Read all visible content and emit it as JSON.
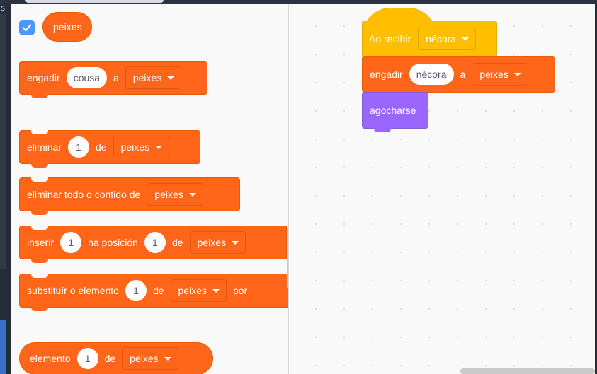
{
  "window": {
    "edge_letter": "s"
  },
  "palette": {
    "variable_checked": true,
    "variable_name": "peixes",
    "blocks": {
      "add": {
        "label1": "engadir",
        "text": "cousa",
        "label2": "a",
        "list": "peixes"
      },
      "delete": {
        "label1": "eliminar",
        "num": "1",
        "label2": "de",
        "list": "peixes"
      },
      "delete_all": {
        "label1": "eliminar todo o contido de",
        "list": "peixes"
      },
      "insert": {
        "label1": "inserir",
        "num1": "1",
        "label2": "na posición",
        "num2": "1",
        "label3": "de",
        "list": "peixes"
      },
      "replace": {
        "label1": "substituír o elemento",
        "num": "1",
        "label2": "de",
        "list": "peixes",
        "label3": "por"
      },
      "item": {
        "label1": "elemento",
        "num": "1",
        "label2": "de",
        "list": "peixes"
      }
    }
  },
  "workspace": {
    "hat": {
      "label": "Ao recibir",
      "message": "nécora"
    },
    "add": {
      "label1": "engadir",
      "text": "nécora",
      "label2": "a",
      "list": "peixes"
    },
    "hide": {
      "label": "agocharse"
    }
  },
  "colors": {
    "list_orange": "#ff661a",
    "events_yellow": "#ffbf00",
    "looks_purple": "#9966ff",
    "checkbox_blue": "#4c97ff"
  },
  "icons": {
    "checkbox": "checkmark-icon",
    "dropdown": "caret-down-icon"
  }
}
